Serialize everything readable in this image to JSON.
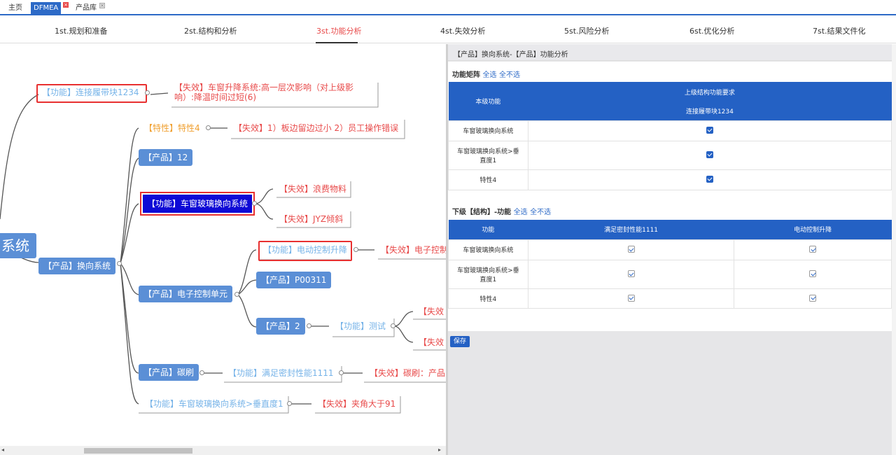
{
  "tabs": [
    {
      "label": "主页",
      "closable": false
    },
    {
      "label": "DFMEA",
      "closable": true,
      "active": true
    },
    {
      "label": "产品库",
      "closable": true
    }
  ],
  "steps": [
    "1st.规划和准备",
    "2st.结构和分析",
    "3st.功能分析",
    "4st.失效分析",
    "5st.风险分析",
    "6st.优化分析",
    "7st.结果文件化"
  ],
  "active_step": 2,
  "mindmap": {
    "root_partial": "系统",
    "func_belt": "【功能】连接履带块1234",
    "fail_window_line1": "【失效】车窗升降系统:高一层次影响（对上级影",
    "fail_window_line2": "响）:降温时间过短(6)",
    "trait4": "【特性】特性4",
    "fail_trait4": "【失效】1）板边留边过小 2）员工操作错误",
    "prod12": "【产品】12",
    "func_window": "【功能】车窗玻璃换向系统",
    "fail_waste": "【失效】浪费物料",
    "fail_jyz": "【失效】JYZ倾斜",
    "prod_switch": "【产品】换向系统",
    "func_electric": "【功能】电动控制升降",
    "fail_electric": "【失效】电子控制",
    "prod_p00311": "【产品】P00311",
    "prod_ecu": "【产品】电子控制单元",
    "prod2": "【产品】2",
    "func_test": "【功能】测试",
    "fail_partial_a": "【失效",
    "fail_partial_b": "【失效",
    "prod_brush": "【产品】碳刷",
    "func_seal": "【功能】满足密封性能1111",
    "fail_brush": "【失效】碳刷：产品",
    "func_vertical": "【功能】车窗玻璃换向系统>垂直度1",
    "fail_angle": "【失效】夹角大于91"
  },
  "panel": {
    "title": "【产品】换向系统-【产品】功能分析",
    "matrix_label": "功能矩阵",
    "select_all": "全选",
    "select_none": "全不选",
    "matrix_header_left": "本级功能",
    "matrix_header_top": "上级结构功能要求",
    "matrix_header_sub": "连接履带块1234",
    "matrix_rows": [
      {
        "label": "车窗玻璃换向系统",
        "checked": true
      },
      {
        "label_line1": "车窗玻璃换向系统>垂",
        "label_line2": "直度1",
        "checked": true
      },
      {
        "label": "特性4",
        "checked": true
      }
    ],
    "lower_label": "下级【结构】-功能",
    "lower_headers": [
      "功能",
      "满足密封性能1111",
      "电动控制升降"
    ],
    "lower_rows": [
      {
        "label": "车窗玻璃换向系统",
        "c1": true,
        "c2": true
      },
      {
        "label_line1": "车窗玻璃换向系统>垂",
        "label_line2": "直度1",
        "c1": true,
        "c2": true
      },
      {
        "label": "特性4",
        "c1": true,
        "c2": true
      }
    ],
    "save": "保存"
  },
  "colors": {
    "accent": "#2461c4",
    "active_step": "#e84a4a",
    "selected_node": "#0e0ad6",
    "highlight_border": "#e83030"
  }
}
